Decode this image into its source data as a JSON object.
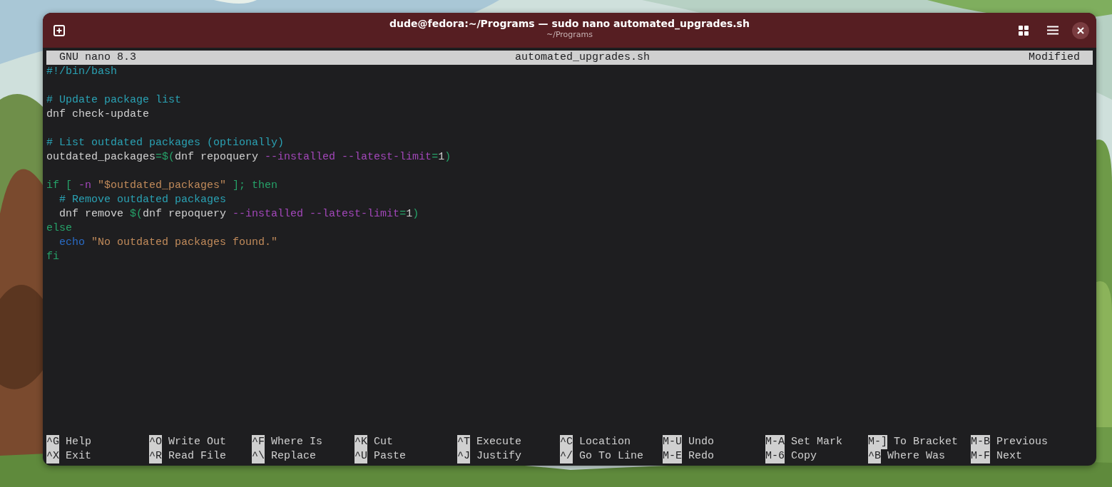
{
  "window": {
    "title": "dude@fedora:~/Programs — sudo nano automated_upgrades.sh",
    "subtitle": "~/Programs"
  },
  "nano_header": {
    "version": "GNU nano 8.3",
    "filename": "automated_upgrades.sh",
    "status": "Modified"
  },
  "lines": [
    {
      "kind": "code",
      "tokens": [
        {
          "kind": "comment",
          "text": "#!/bin/bash"
        }
      ]
    },
    {
      "kind": "blank"
    },
    {
      "kind": "code",
      "tokens": [
        {
          "kind": "comment",
          "text": "# Update package list"
        }
      ]
    },
    {
      "kind": "code",
      "tokens": [
        {
          "kind": "plain",
          "text": "dnf check-update"
        }
      ]
    },
    {
      "kind": "blank"
    },
    {
      "kind": "code",
      "tokens": [
        {
          "kind": "comment",
          "text": "# List outdated packages (optionally)"
        }
      ]
    },
    {
      "kind": "code",
      "tokens": [
        {
          "kind": "plain",
          "text": "outdated_packages"
        },
        {
          "kind": "operator",
          "text": "=$("
        },
        {
          "kind": "plain",
          "text": "dnf repoquery "
        },
        {
          "kind": "flag",
          "text": "--installed --latest-limit"
        },
        {
          "kind": "operator",
          "text": "="
        },
        {
          "kind": "plain",
          "text": "1"
        },
        {
          "kind": "operator",
          "text": ")"
        }
      ]
    },
    {
      "kind": "blank"
    },
    {
      "kind": "code",
      "tokens": [
        {
          "kind": "keyword",
          "text": "if [ "
        },
        {
          "kind": "flag",
          "text": "-n "
        },
        {
          "kind": "string",
          "text": "\"$outdated_packages\""
        },
        {
          "kind": "keyword",
          "text": " ]; then"
        }
      ]
    },
    {
      "kind": "code",
      "tokens": [
        {
          "kind": "comment",
          "text": "  # Remove outdated packages"
        }
      ]
    },
    {
      "kind": "code",
      "tokens": [
        {
          "kind": "plain",
          "text": "  dnf remove "
        },
        {
          "kind": "operator",
          "text": "$("
        },
        {
          "kind": "plain",
          "text": "dnf repoquery "
        },
        {
          "kind": "flag",
          "text": "--installed --latest-limit"
        },
        {
          "kind": "operator",
          "text": "="
        },
        {
          "kind": "plain",
          "text": "1"
        },
        {
          "kind": "operator",
          "text": ")"
        }
      ]
    },
    {
      "kind": "code",
      "tokens": [
        {
          "kind": "keyword",
          "text": "else"
        }
      ]
    },
    {
      "kind": "code",
      "tokens": [
        {
          "kind": "builtin",
          "text": "  echo "
        },
        {
          "kind": "string",
          "text": "\"No outdated packages found.\""
        }
      ]
    },
    {
      "kind": "code",
      "tokens": [
        {
          "kind": "keyword",
          "text": "fi"
        }
      ]
    }
  ],
  "shortcut_rows": [
    [
      {
        "key": "^G",
        "label": "Help"
      },
      {
        "key": "^O",
        "label": "Write Out"
      },
      {
        "key": "^F",
        "label": "Where Is"
      },
      {
        "key": "^K",
        "label": "Cut"
      },
      {
        "key": "^T",
        "label": "Execute"
      },
      {
        "key": "^C",
        "label": "Location"
      },
      {
        "key": "M-U",
        "label": "Undo"
      },
      {
        "key": "M-A",
        "label": "Set Mark"
      },
      {
        "key": "M-]",
        "label": "To Bracket"
      },
      {
        "key": "M-B",
        "label": "Previous"
      }
    ],
    [
      {
        "key": "^X",
        "label": "Exit"
      },
      {
        "key": "^R",
        "label": "Read File"
      },
      {
        "key": "^\\",
        "label": "Replace"
      },
      {
        "key": "^U",
        "label": "Paste"
      },
      {
        "key": "^J",
        "label": "Justify"
      },
      {
        "key": "^/",
        "label": "Go To Line"
      },
      {
        "key": "M-E",
        "label": "Redo"
      },
      {
        "key": "M-6",
        "label": "Copy"
      },
      {
        "key": "^B",
        "label": "Where Was"
      },
      {
        "key": "M-F",
        "label": "Next"
      }
    ]
  ]
}
